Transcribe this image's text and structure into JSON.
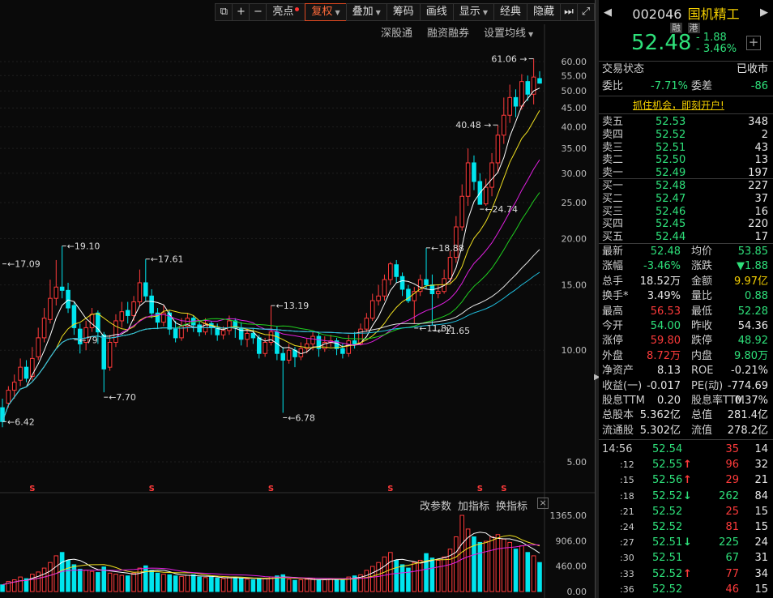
{
  "toolbar": {
    "expand_icon": "expand-icon",
    "plus": "+",
    "minus": "−",
    "highlight": "亮点",
    "restore_rights": "复权",
    "overlay": "叠加",
    "chips": "筹码",
    "draw_line": "画线",
    "display": "显示",
    "classic": "经典",
    "hide": "隐藏",
    "more": "⏭",
    "fullscreen": "⤢"
  },
  "subbar": {
    "sz_connect": "深股通",
    "margin": "融资融券",
    "set_ma": "设置均线"
  },
  "indicator_bar": {
    "change_param": "改参数",
    "add_indicator": "加指标",
    "switch_indicator": "换指标",
    "close": "×"
  },
  "chart_data": {
    "type": "candlestick",
    "price_axis_labels": [
      "60.00",
      "55.00",
      "50.00",
      "45.00",
      "40.00",
      "35.00",
      "30.00",
      "25.00",
      "20.00",
      "15.00",
      "10.00",
      "5.00"
    ],
    "price_axis_values": [
      60,
      55,
      50,
      45,
      40,
      35,
      30,
      25,
      20,
      15,
      10,
      5
    ],
    "volume_axis_labels": [
      "1365.00",
      "906.00",
      "460.00",
      "0.00"
    ],
    "annotations": [
      {
        "text": "61.06",
        "price": 61.06
      },
      {
        "text": "40.48",
        "price": 40.48
      },
      {
        "text": "24.74",
        "price": 24.74
      },
      {
        "text": "19.10",
        "price": 19.1
      },
      {
        "text": "17.61",
        "price": 17.61
      },
      {
        "text": "17.09",
        "price": 17.09
      },
      {
        "text": "18.88",
        "price": 18.88
      },
      {
        "text": "13.19",
        "price": 13.19
      },
      {
        "text": "11.82",
        "price": 11.82
      },
      {
        "text": "11.65",
        "price": 11.65
      },
      {
        "text": "7.70",
        "price": 7.7
      },
      {
        "text": "6.78",
        "price": 6.78
      },
      {
        "text": "6.42",
        "price": 6.42
      },
      {
        "text": "79",
        "price": 11.0
      }
    ],
    "candles": [
      [
        7.0,
        6.42,
        7.4,
        6.2
      ],
      [
        7.2,
        7.8,
        8.0,
        7.0
      ],
      [
        7.8,
        8.2,
        8.6,
        7.4
      ],
      [
        8.3,
        9.0,
        9.5,
        8.0
      ],
      [
        9.0,
        8.4,
        9.4,
        8.2
      ],
      [
        8.5,
        9.5,
        10.2,
        8.3
      ],
      [
        9.6,
        10.8,
        11.5,
        9.4
      ],
      [
        10.8,
        12.2,
        13.0,
        10.5
      ],
      [
        12.1,
        13.8,
        15.5,
        11.8
      ],
      [
        13.8,
        14.8,
        17.5,
        13.2
      ],
      [
        14.8,
        14.5,
        19.1,
        13.8
      ],
      [
        14.5,
        13.0,
        15.2,
        12.6
      ],
      [
        13.2,
        11.5,
        13.5,
        11.0
      ],
      [
        11.4,
        10.4,
        11.8,
        9.8
      ],
      [
        10.5,
        11.5,
        12.0,
        10.0
      ],
      [
        11.5,
        12.5,
        13.0,
        11.2
      ],
      [
        12.6,
        11.2,
        12.8,
        10.4
      ],
      [
        11.0,
        8.9,
        11.2,
        7.7
      ],
      [
        9.0,
        10.5,
        11.0,
        8.8
      ],
      [
        10.5,
        12.0,
        12.5,
        10.2
      ],
      [
        12.0,
        12.7,
        13.5,
        11.5
      ],
      [
        12.8,
        12.4,
        13.5,
        11.8
      ],
      [
        12.4,
        13.5,
        14.0,
        12.0
      ],
      [
        13.5,
        15.2,
        16.5,
        13.2
      ],
      [
        15.2,
        14.0,
        17.61,
        13.6
      ],
      [
        14.0,
        12.6,
        14.6,
        12.2
      ],
      [
        12.6,
        11.9,
        13.0,
        11.4
      ],
      [
        11.9,
        12.6,
        13.2,
        11.6
      ],
      [
        12.6,
        11.4,
        12.8,
        11.0
      ],
      [
        11.4,
        10.8,
        12.0,
        10.5
      ],
      [
        10.8,
        11.6,
        12.2,
        10.6
      ],
      [
        11.6,
        12.2,
        12.6,
        11.2
      ],
      [
        12.2,
        11.7,
        12.4,
        11.2
      ],
      [
        11.7,
        11.2,
        12.0,
        10.9
      ],
      [
        11.2,
        11.8,
        12.2,
        11.0
      ],
      [
        11.8,
        11.5,
        12.0,
        11.0
      ],
      [
        11.5,
        11.0,
        11.8,
        10.6
      ],
      [
        11.0,
        11.3,
        11.6,
        10.7
      ],
      [
        11.3,
        12.0,
        12.4,
        11.0
      ],
      [
        12.0,
        11.5,
        12.2,
        10.8
      ],
      [
        11.5,
        10.7,
        11.9,
        10.3
      ],
      [
        10.7,
        11.1,
        11.5,
        10.2
      ],
      [
        11.1,
        10.8,
        11.4,
        10.4
      ],
      [
        10.8,
        9.8,
        11.0,
        9.5
      ],
      [
        9.8,
        10.5,
        10.8,
        9.6
      ],
      [
        10.5,
        11.2,
        13.19,
        10.3
      ],
      [
        11.2,
        9.8,
        11.6,
        9.4
      ],
      [
        9.8,
        9.4,
        10.2,
        6.78
      ],
      [
        9.4,
        10.0,
        10.4,
        9.2
      ],
      [
        10.0,
        9.6,
        10.2,
        9.0
      ],
      [
        9.6,
        10.1,
        10.5,
        9.4
      ],
      [
        10.1,
        10.4,
        10.8,
        9.8
      ],
      [
        10.4,
        10.9,
        11.2,
        10.0
      ],
      [
        10.9,
        10.1,
        11.2,
        9.6
      ],
      [
        10.1,
        10.5,
        10.9,
        9.9
      ],
      [
        10.5,
        10.6,
        11.0,
        10.2
      ],
      [
        10.6,
        10.1,
        10.8,
        9.7
      ],
      [
        10.1,
        9.8,
        10.4,
        9.5
      ],
      [
        9.8,
        10.6,
        11.0,
        9.6
      ],
      [
        10.6,
        10.4,
        11.2,
        10.1
      ],
      [
        10.4,
        11.4,
        11.8,
        10.3
      ],
      [
        11.4,
        12.2,
        12.6,
        11.2
      ],
      [
        12.2,
        13.6,
        14.2,
        12.0
      ],
      [
        13.6,
        14.0,
        15.0,
        13.2
      ],
      [
        14.0,
        15.5,
        16.0,
        13.6
      ],
      [
        15.5,
        17.09,
        17.3,
        15.0
      ],
      [
        17.0,
        15.8,
        17.5,
        15.2
      ],
      [
        15.8,
        14.6,
        16.2,
        14.0
      ],
      [
        14.6,
        13.6,
        15.0,
        13.4
      ],
      [
        13.6,
        14.4,
        14.8,
        11.82
      ],
      [
        14.4,
        15.5,
        16.0,
        14.0
      ],
      [
        15.5,
        15.0,
        18.88,
        14.6
      ],
      [
        15.0,
        14.2,
        16.0,
        11.65
      ],
      [
        14.2,
        14.4,
        15.0,
        13.8
      ],
      [
        14.4,
        15.6,
        16.5,
        14.2
      ],
      [
        15.6,
        17.8,
        18.5,
        15.2
      ],
      [
        17.8,
        21.5,
        23.0,
        17.2
      ],
      [
        21.5,
        26.0,
        28.0,
        21.0
      ],
      [
        26.0,
        32.0,
        35.0,
        24.5
      ],
      [
        32.0,
        28.5,
        33.5,
        27.0
      ],
      [
        28.5,
        24.74,
        30.0,
        24.74
      ],
      [
        24.8,
        27.5,
        29.0,
        24.5
      ],
      [
        27.5,
        32.0,
        34.0,
        26.0
      ],
      [
        32.0,
        38.0,
        40.48,
        30.0
      ],
      [
        38.0,
        43.0,
        48.0,
        36.0
      ],
      [
        43.0,
        48.0,
        52.0,
        41.0
      ],
      [
        48.0,
        45.5,
        50.5,
        42.5
      ],
      [
        45.5,
        53.0,
        55.5,
        44.5
      ],
      [
        53.0,
        49.0,
        55.0,
        47.0
      ],
      [
        49.0,
        54.5,
        61.06,
        46.0
      ],
      [
        54.0,
        52.48,
        56.53,
        52.28
      ]
    ],
    "ma_lines": [
      {
        "name": "MA5",
        "color": "#ffffff"
      },
      {
        "name": "MA10",
        "color": "#f0e020"
      },
      {
        "name": "MA20",
        "color": "#e020e0"
      },
      {
        "name": "MA30",
        "color": "#20d020"
      },
      {
        "name": "MA60",
        "color": "#e0e0e0"
      },
      {
        "name": "MA120",
        "color": "#20c0e0"
      }
    ],
    "volume": [
      120,
      180,
      210,
      260,
      230,
      310,
      350,
      420,
      520,
      640,
      700,
      560,
      480,
      400,
      380,
      360,
      340,
      440,
      330,
      310,
      290,
      280,
      330,
      420,
      460,
      380,
      330,
      310,
      300,
      280,
      270,
      290,
      300,
      260,
      250,
      260,
      240,
      230,
      250,
      260,
      240,
      220,
      210,
      240,
      230,
      260,
      280,
      300,
      220,
      200,
      210,
      220,
      230,
      200,
      210,
      220,
      230,
      210,
      260,
      280,
      300,
      380,
      450,
      520,
      620,
      700,
      560,
      480,
      420,
      520,
      560,
      680,
      600,
      560,
      620,
      760,
      980,
      1365,
      1120,
      980,
      880,
      900,
      980,
      1020,
      940,
      880,
      760,
      820,
      700,
      640,
      520
    ],
    "volume_colors_note": "red hollow = up, cyan solid = down",
    "margin_markers": [
      "S",
      "S",
      "S",
      "S",
      "S",
      "S"
    ],
    "margin_marker_candle_index": [
      5,
      25,
      45,
      65,
      80,
      84
    ]
  },
  "quote": {
    "code": "002046",
    "name": "国机精工",
    "tag_rong": "融",
    "tag_gang": "港",
    "price": "52.48",
    "change": "- 1.88",
    "change_pct": "- 3.46%",
    "add_icon": "+",
    "status_label": "交易状态",
    "status_value": "已收市",
    "weibi_label": "委比",
    "weibi_value": "-7.71%",
    "weicha_label": "委差",
    "weicha_value": "-86",
    "promo": "抓住机会，即刻开户!"
  },
  "order_book": {
    "asks": [
      {
        "label": "卖五",
        "price": "52.53",
        "vol": "348"
      },
      {
        "label": "卖四",
        "price": "52.52",
        "vol": "2"
      },
      {
        "label": "卖三",
        "price": "52.51",
        "vol": "43"
      },
      {
        "label": "卖二",
        "price": "52.50",
        "vol": "13"
      },
      {
        "label": "卖一",
        "price": "52.49",
        "vol": "197"
      }
    ],
    "bids": [
      {
        "label": "买一",
        "price": "52.48",
        "vol": "227"
      },
      {
        "label": "买二",
        "price": "52.47",
        "vol": "37"
      },
      {
        "label": "买三",
        "price": "52.46",
        "vol": "16"
      },
      {
        "label": "买四",
        "price": "52.45",
        "vol": "220"
      },
      {
        "label": "买五",
        "price": "52.44",
        "vol": "17"
      }
    ]
  },
  "stats": [
    {
      "l1": "最新",
      "v1": "52.48",
      "c1": "g",
      "l2": "均价",
      "v2": "53.85",
      "c2": "g"
    },
    {
      "l1": "涨幅",
      "v1": "-3.46%",
      "c1": "g",
      "l2": "涨跌",
      "v2": "▼1.88",
      "c2": "g"
    },
    {
      "l1": "总手",
      "v1": "18.52万",
      "c1": "w",
      "l2": "金额",
      "v2": "9.97亿",
      "c2": "y"
    },
    {
      "l1": "换手*",
      "v1": "3.49%",
      "c1": "w",
      "l2": "量比",
      "v2": "0.88",
      "c2": "g"
    },
    {
      "l1": "最高",
      "v1": "56.53",
      "c1": "r",
      "l2": "最低",
      "v2": "52.28",
      "c2": "g"
    },
    {
      "l1": "今开",
      "v1": "54.00",
      "c1": "g",
      "l2": "昨收",
      "v2": "54.36",
      "c2": "w"
    },
    {
      "l1": "涨停",
      "v1": "59.80",
      "c1": "r",
      "l2": "跌停",
      "v2": "48.92",
      "c2": "g"
    },
    {
      "l1": "外盘",
      "v1": "8.72万",
      "c1": "r",
      "l2": "内盘",
      "v2": "9.80万",
      "c2": "g"
    },
    {
      "l1": "净资产",
      "v1": "8.13",
      "c1": "w",
      "l2": "ROE",
      "v2": "-0.21%",
      "c2": "w"
    },
    {
      "l1": "收益(一)",
      "v1": "-0.017",
      "c1": "w",
      "l2": "PE(动)",
      "v2": "-774.69",
      "c2": "w"
    },
    {
      "l1": "股息TTM",
      "v1": "0.20",
      "c1": "w",
      "l2": "股息率TTM",
      "v2": "0.37%",
      "c2": "w"
    },
    {
      "l1": "总股本",
      "v1": "5.362亿",
      "c1": "w",
      "l2": "总值",
      "v2": "281.4亿",
      "c2": "w"
    },
    {
      "l1": "流通股",
      "v1": "5.302亿",
      "c1": "w",
      "l2": "流值",
      "v2": "278.2亿",
      "c2": "w"
    }
  ],
  "ticks": [
    {
      "time": "14:56",
      "price": "52.54",
      "arrow": "",
      "vol": "35",
      "vc": "r",
      "n": "14"
    },
    {
      "time": ":12",
      "price": "52.55",
      "arrow": "↑",
      "vol": "96",
      "vc": "r",
      "n": "32"
    },
    {
      "time": ":15",
      "price": "52.56",
      "arrow": "↑",
      "vol": "29",
      "vc": "r",
      "n": "21"
    },
    {
      "time": ":18",
      "price": "52.52",
      "arrow": "↓",
      "vol": "262",
      "vc": "g",
      "n": "84"
    },
    {
      "time": ":21",
      "price": "52.52",
      "arrow": "",
      "vol": "25",
      "vc": "r",
      "n": "15"
    },
    {
      "time": ":24",
      "price": "52.52",
      "arrow": "",
      "vol": "81",
      "vc": "r",
      "n": "15"
    },
    {
      "time": ":27",
      "price": "52.51",
      "arrow": "↓",
      "vol": "225",
      "vc": "g",
      "n": "24"
    },
    {
      "time": ":30",
      "price": "52.51",
      "arrow": "",
      "vol": "67",
      "vc": "g",
      "n": "31"
    },
    {
      "time": ":33",
      "price": "52.52",
      "arrow": "↑",
      "vol": "77",
      "vc": "r",
      "n": "34"
    },
    {
      "time": ":36",
      "price": "52.52",
      "arrow": "",
      "vol": "46",
      "vc": "r",
      "n": "15"
    }
  ]
}
